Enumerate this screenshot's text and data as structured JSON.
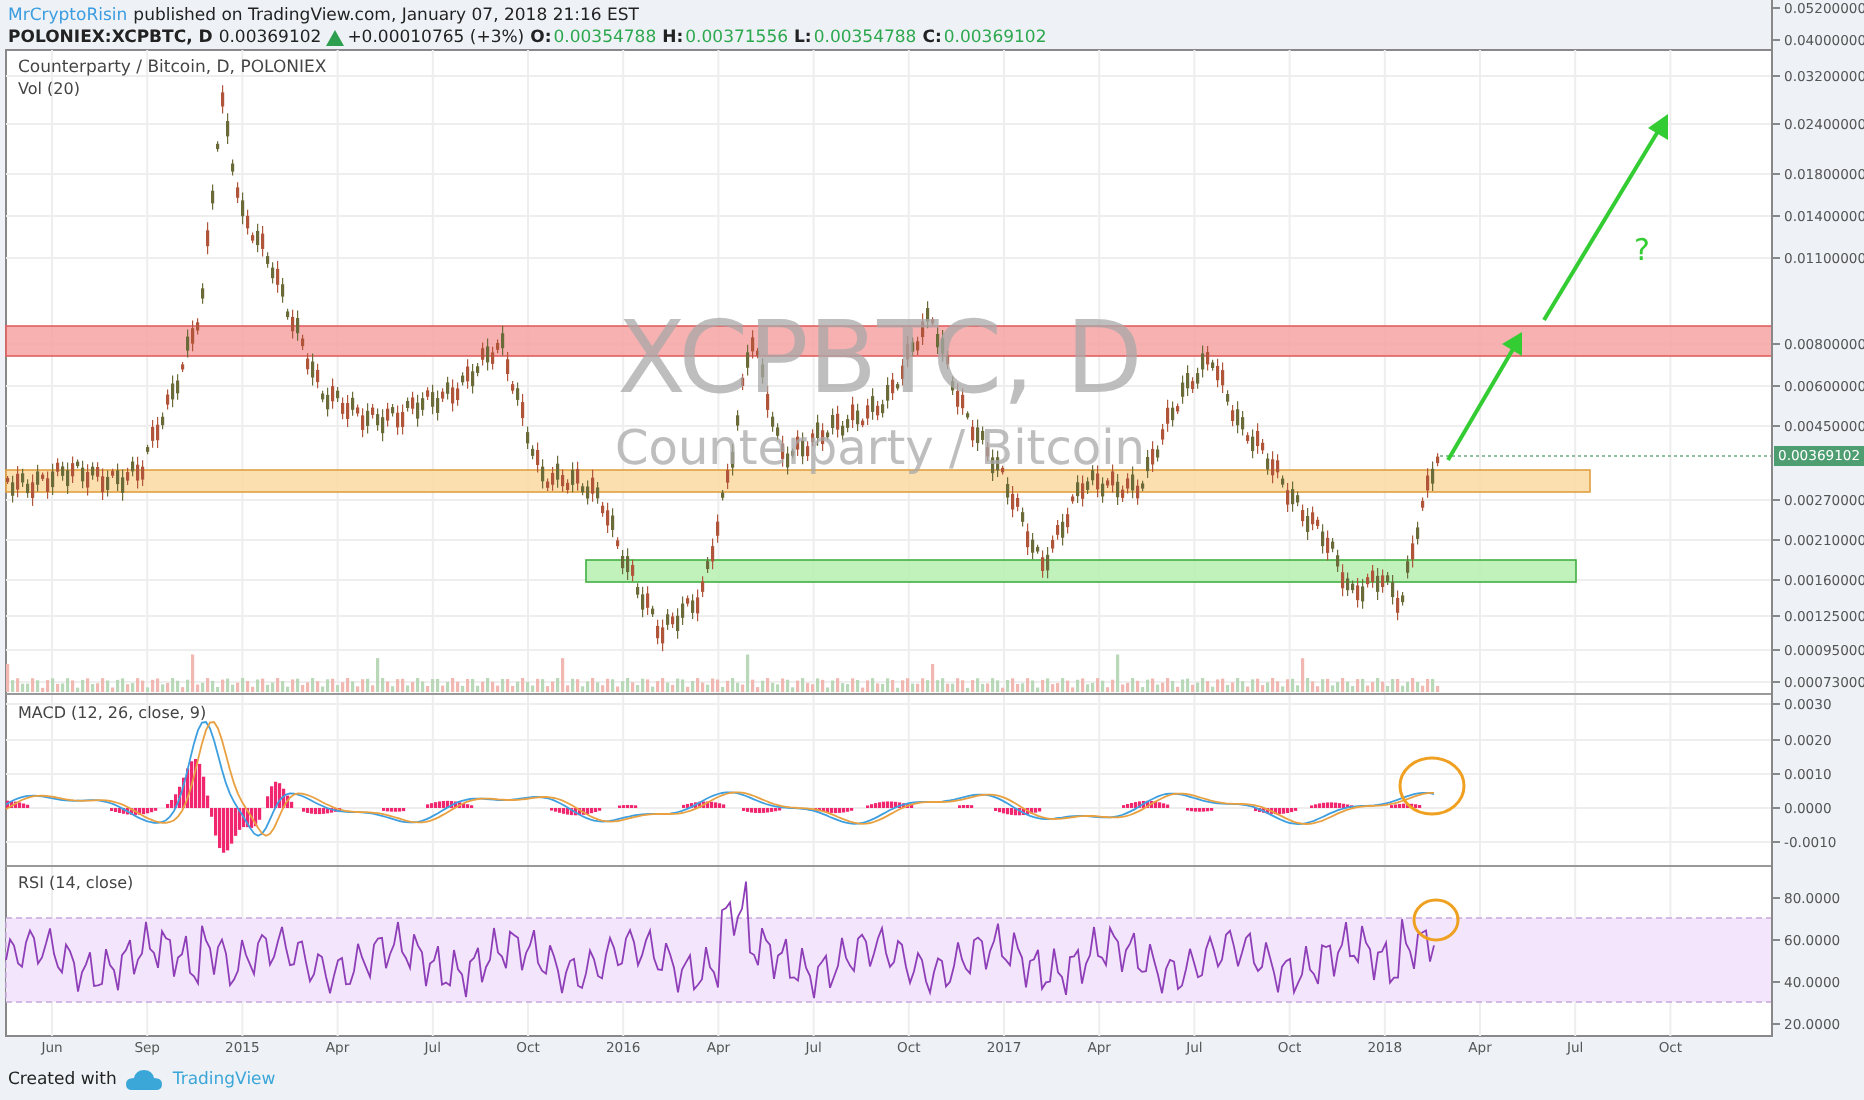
{
  "header": {
    "author": "MrCryptoRisin",
    "published": "published on TradingView.com, January 07, 2018 21:16 EST"
  },
  "quote": {
    "symbol": "POLONIEX:XCPBTC, D",
    "price": "0.00369102",
    "change_up": true,
    "change": "+0.00010765 (+3%)",
    "open_label": "O:",
    "open": "0.00354788",
    "high_label": "H:",
    "high": "0.00371556",
    "low_label": "L:",
    "low": "0.00354788",
    "close_label": "C:",
    "close": "0.00369102"
  },
  "price_pane": {
    "title": "Counterparty / Bitcoin, D, POLONIEX",
    "volume_label": "Vol (20)",
    "watermark_symbol": "XCPBTC, D",
    "watermark_name": "Counterparty / Bitcoin",
    "axis_ticks": [
      "0.05200000",
      "0.04000000",
      "0.03200000",
      "0.02400000",
      "0.01800000",
      "0.01400000",
      "0.01100000",
      "0.00800000",
      "0.00600000",
      "0.00450000",
      "0.00270000",
      "0.00210000",
      "0.00160000",
      "0.00125000",
      "0.00095000",
      "0.00073000"
    ],
    "last_price": "0.00369102",
    "annotation": "?",
    "zones": [
      {
        "kind": "resistance",
        "color": "#f7a3a3"
      },
      {
        "kind": "pivot",
        "color": "#fcd9a0"
      },
      {
        "kind": "support",
        "color": "#b6f0b0"
      }
    ]
  },
  "macd_pane": {
    "title": "MACD (12, 26, close, 9)",
    "axis_ticks": [
      "0.0030",
      "0.0020",
      "0.0010",
      "0.0000",
      "-0.0010"
    ]
  },
  "rsi_pane": {
    "title": "RSI (14, close)",
    "axis_ticks": [
      "80.0000",
      "60.0000",
      "40.0000",
      "20.0000"
    ]
  },
  "time_axis": [
    "Jun",
    "Sep",
    "2015",
    "Apr",
    "Jul",
    "Oct",
    "2016",
    "Apr",
    "Jul",
    "Oct",
    "2017",
    "Apr",
    "Jul",
    "Oct",
    "2018",
    "Apr",
    "Jul",
    "Oct"
  ],
  "footer": {
    "text": "Created with",
    "brand": "TradingView"
  }
}
